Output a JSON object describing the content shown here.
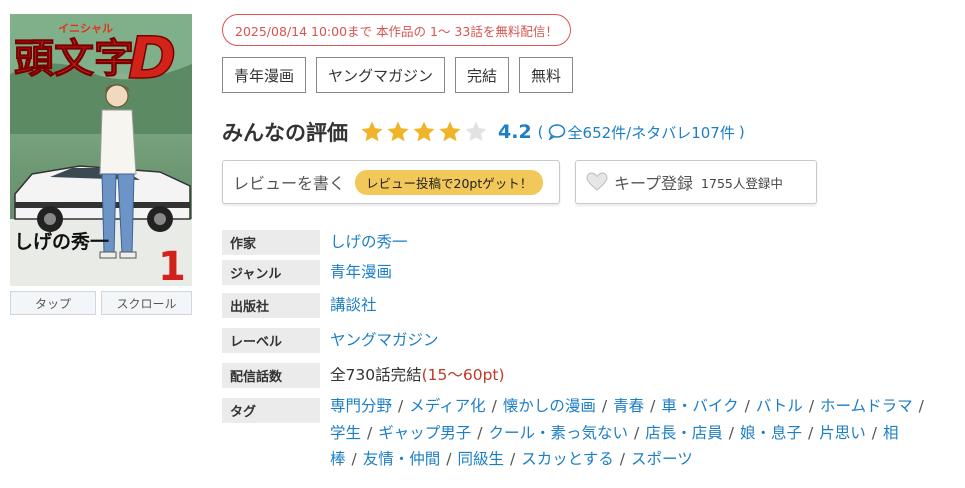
{
  "cover": {
    "subtitle_kana": "イニシャル",
    "title_kanji": "頭文字",
    "title_letter": "D",
    "author": "しげの秀一",
    "volume": "1"
  },
  "view_buttons": [
    "タップ",
    "スクロール"
  ],
  "campaign": "2025/08/14 10:00まで 本作品の 1～ 33話を無料配信！",
  "tags": [
    "青年漫画",
    "ヤングマガジン",
    "完結",
    "無料"
  ],
  "rating": {
    "title": "みんなの評価",
    "score": "4.2",
    "stars_filled": 4,
    "stars_total": 5,
    "open_paren": "(",
    "counts": "全652件/ネタバレ107件",
    "close_paren": ")"
  },
  "review_button": {
    "label": "レビューを書く",
    "badge": "レビュー投稿で20ptゲット！"
  },
  "keep_button": {
    "label": "キープ登録",
    "count": "1755人登録中"
  },
  "info": {
    "author": {
      "label": "作家",
      "value": "しげの秀一"
    },
    "genre": {
      "label": "ジャンル",
      "value": "青年漫画"
    },
    "publisher": {
      "label": "出版社",
      "value": "講談社"
    },
    "label_row": {
      "label": "レーベル",
      "value": "ヤングマガジン"
    },
    "episodes": {
      "label": "配信話数",
      "value": "全730話完結",
      "price": "(15～60pt)"
    },
    "tags": {
      "label": "タグ",
      "items": [
        "専門分野",
        "メディア化",
        "懐かしの漫画",
        "青春",
        "車・バイク",
        "バトル",
        "ホームドラマ",
        "学生",
        "ギャップ男子",
        "クール・素っ気ない",
        "店長・店員",
        "娘・息子",
        "片思い",
        "相棒",
        "友情・仲間",
        "同級生",
        "スカッとする",
        "スポーツ"
      ]
    }
  },
  "colors": {
    "accent_blue": "#1c7fc6",
    "campaign_red": "#d9534f",
    "star_gold": "#f0b429",
    "badge_yellow": "#f2c85b"
  }
}
